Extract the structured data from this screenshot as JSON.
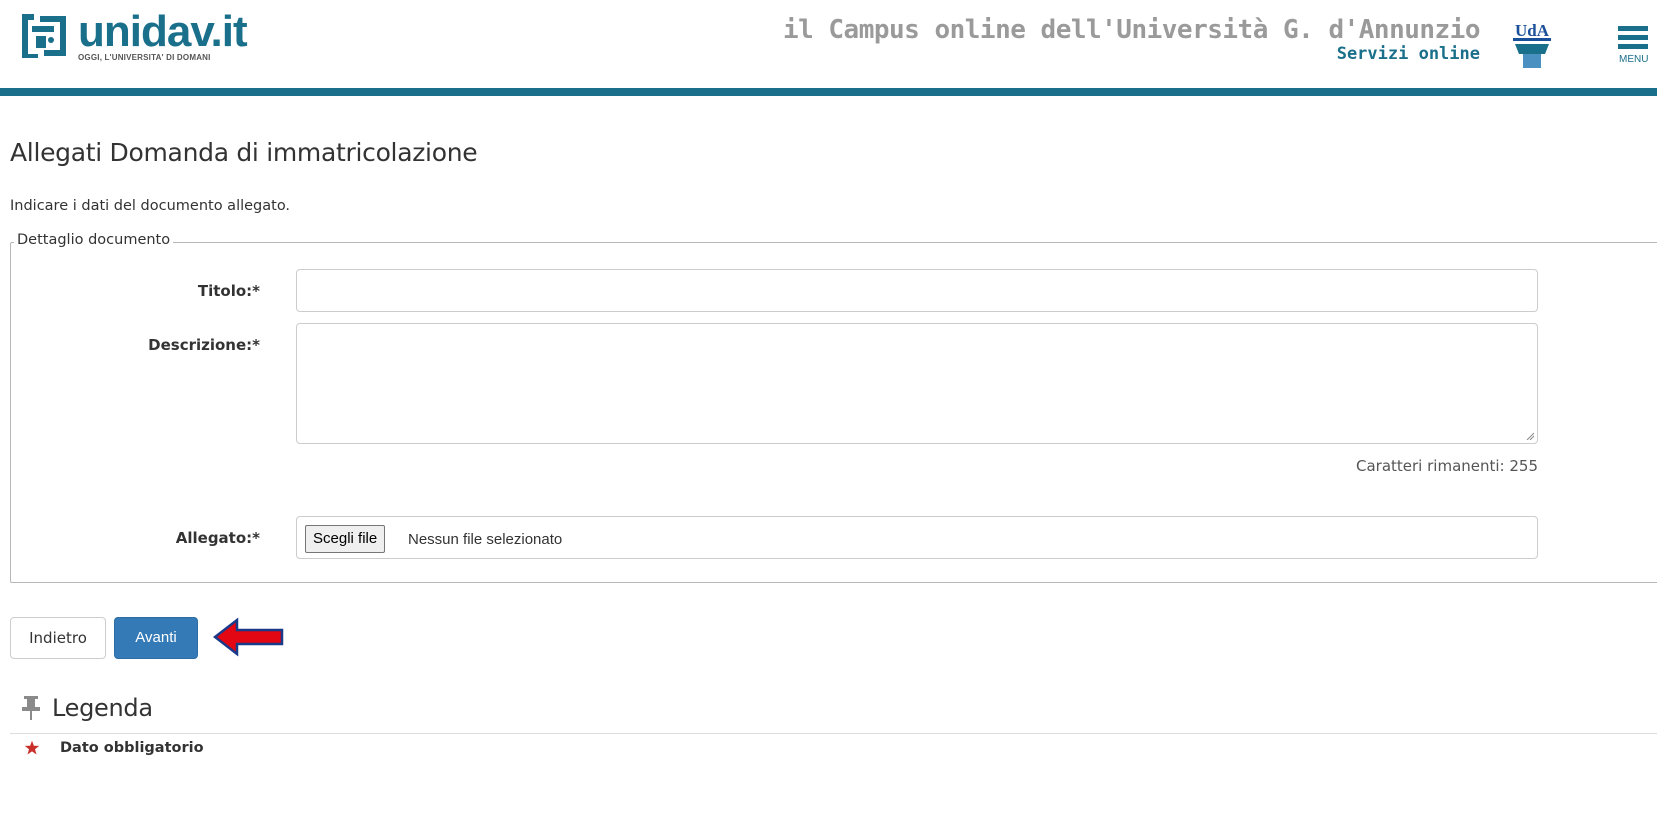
{
  "header": {
    "logo_word": "unidav.it",
    "logo_tagline": "OGGI, L'UNIVERSITA' DI DOMANI",
    "campus_title": "il Campus online dell'Università G. d'Annunzio",
    "campus_subtitle": "Servizi online",
    "uda_logo_text": "UdA",
    "menu_label": "MENU"
  },
  "main": {
    "title": "Allegati Domanda di immatricolazione",
    "intro": "Indicare i dati del documento allegato."
  },
  "form": {
    "legend": "Dettaglio documento",
    "title_label": "Titolo:*",
    "title_value": "",
    "description_label": "Descrizione:*",
    "description_value": "",
    "chars_remaining": "Caratteri rimanenti: 255",
    "attachment_label": "Allegato:*",
    "file_button": "Scegli file",
    "file_status": "Nessun file selezionato"
  },
  "actions": {
    "back_label": "Indietro",
    "next_label": "Avanti"
  },
  "legenda": {
    "title": "Legenda",
    "items": [
      {
        "icon": "required-star-icon",
        "label": "Dato obbligatorio"
      }
    ]
  },
  "colors": {
    "brand": "#1a6f8a",
    "primary_button": "#337ab7",
    "arrow": "#e30613",
    "required_star": "#c9302c"
  }
}
